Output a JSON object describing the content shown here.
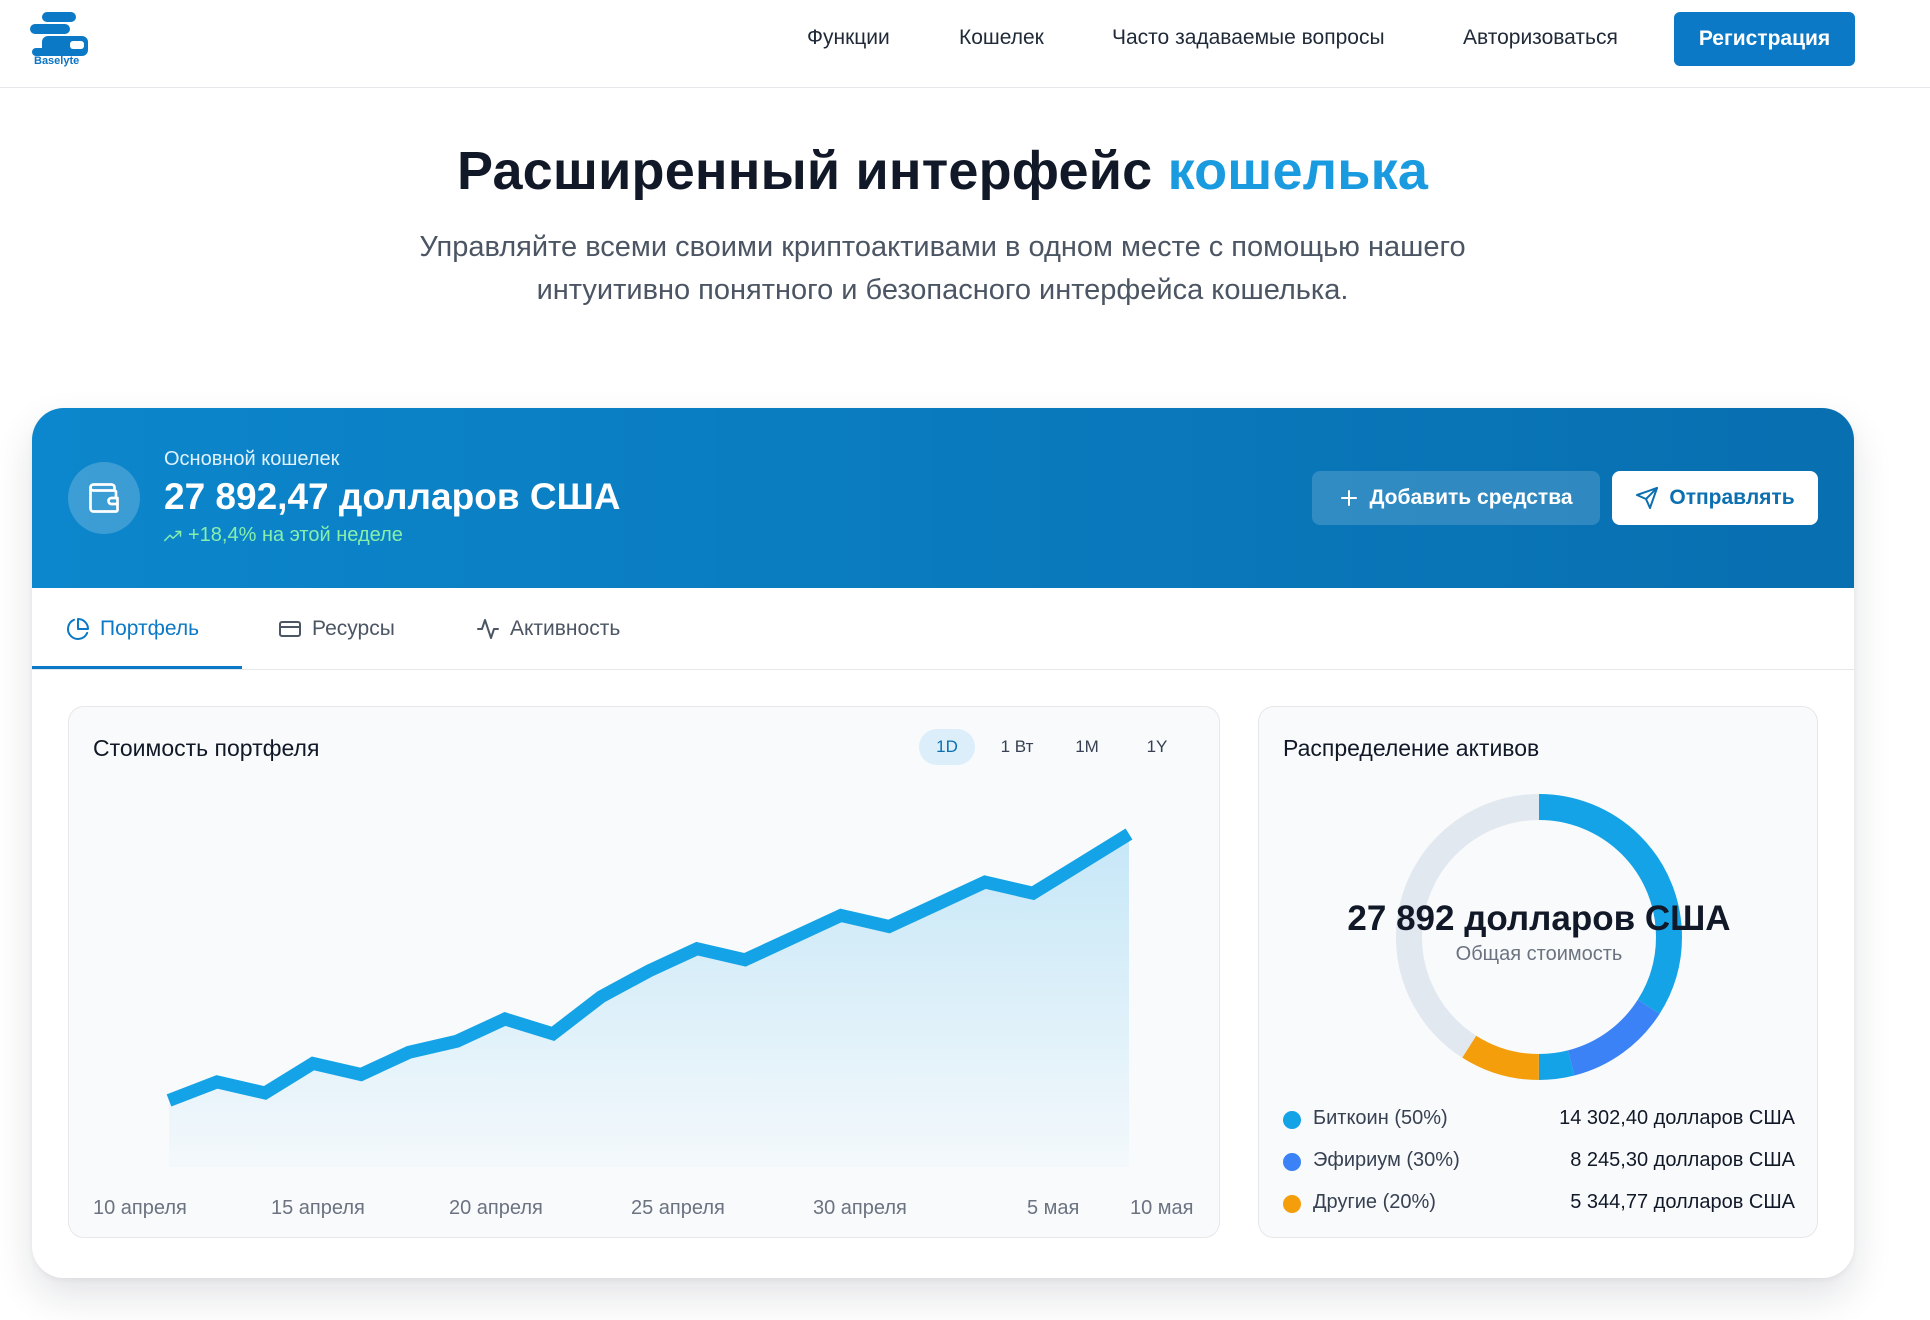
{
  "header": {
    "logo_text": "Baselyte",
    "nav": [
      "Функции",
      "Кошелек",
      "Часто задаваемые вопросы",
      "Авторизоваться"
    ],
    "register_label": "Регистрация",
    "brand_color": "#0b79c6"
  },
  "hero": {
    "title_main": "Расширенный интерфейс",
    "title_accent": "кошелька",
    "subtitle": "Управляйте всеми своими криптоактивами в одном месте с помощью нашего интуитивно понятного и безопасного интерфейса кошелька."
  },
  "wallet": {
    "label": "Основной кошелек",
    "balance": "27 892,47 долларов США",
    "change": "+18,4% на этой неделе",
    "add_funds_label": "Добавить средства",
    "send_label": "Отправлять",
    "icon": "wallet-icon"
  },
  "tabs": [
    {
      "label": "Портфель",
      "icon": "pie-chart-icon",
      "active": true
    },
    {
      "label": "Ресурсы",
      "icon": "credit-card-icon",
      "active": false
    },
    {
      "label": "Активность",
      "icon": "activity-icon",
      "active": false
    }
  ],
  "portfolio": {
    "title": "Стоимость портфеля",
    "ranges": [
      "1D",
      "1 Вт",
      "1M",
      "1Y"
    ],
    "active_range": "1D"
  },
  "chart_data": {
    "type": "area",
    "x_tick_labels": [
      "10 апреля",
      "15 апреля",
      "20 апреля",
      "25 апреля",
      "30 апреля",
      "5 мая",
      "10 мая"
    ],
    "series": [
      {
        "values": [
          18,
          23,
          20,
          28,
          25,
          31,
          34,
          40,
          36,
          46,
          53,
          59,
          56,
          62,
          68,
          65,
          71,
          77,
          74,
          82,
          90
        ]
      }
    ],
    "ylim": [
      0,
      100
    ],
    "line_color": "#14a3e6",
    "grid": false
  },
  "allocation": {
    "title": "Распределение активов",
    "total": "27 892 долларов США",
    "total_label": "Общая стоимость",
    "items": [
      {
        "label": "Биткоин (50%)",
        "value": "14 302,40 долларов США",
        "percent": 50,
        "color": "#14a3e6"
      },
      {
        "label": "Эфириум (30%)",
        "value": "8 245,30 долларов США",
        "percent": 30,
        "color": "#3b82f6"
      },
      {
        "label": "Другие (20%)",
        "value": "5 344,77 долларов США",
        "percent": 20,
        "color": "#f59e0b"
      }
    ],
    "donut_segments": [
      {
        "name": "Биткоин",
        "fraction": 0.34,
        "color": "#14a3e6"
      },
      {
        "name": "Эфириум",
        "fraction": 0.12,
        "color": "#3b82f6"
      },
      {
        "name": "Биткоин",
        "fraction": 0.04,
        "color": "#14a3e6"
      },
      {
        "name": "Другие",
        "fraction": 0.09,
        "color": "#f59e0b"
      },
      {
        "name": "track",
        "fraction": 0.41,
        "color": "#e2e8f0"
      }
    ]
  }
}
